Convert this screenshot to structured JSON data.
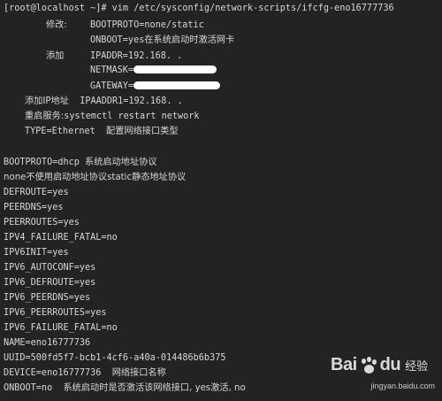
{
  "terminal": {
    "prompt_line": "[root@localhost ~]# vim /etc/sysconfig/network-scripts/ifcfg-eno16777736",
    "notes": {
      "modify_label": "修改:",
      "bootproto_static": "BOOTPROTO=none/static",
      "onboot_label": "ONBOOT=yes",
      "onboot_desc": "在系统启动时激活网卡",
      "add_label": "添加",
      "ipaddr": "IPADDR=192.168. .",
      "netmask": "NETMASK=",
      "gateway": "GATEWAY=",
      "add_ip_label": "添加IP地址",
      "ipaddr1": "IPAADDR1=192.168. .",
      "restart_label": "重启服务:",
      "restart_cmd": "systemctl restart network",
      "type_line": "TYPE=Ethernet",
      "type_desc": "配置网络接口类型"
    },
    "config": {
      "bootproto_dhcp": "BOOTPROTO=dhcp",
      "bootproto_dhcp_desc": "系统启动地址协议",
      "none_desc": "none不使用启动地址协议static静态地址协议",
      "defroute": "DEFROUTE=yes",
      "peerdns": "PEERDNS=yes",
      "peerroutes": "PEERROUTES=yes",
      "ipv4_failure_fatal": "IPV4_FAILURE_FATAL=no",
      "ipv6init": "IPV6INIT=yes",
      "ipv6_autoconf": "IPV6_AUTOCONF=yes",
      "ipv6_defroute": "IPV6_DEFROUTE=yes",
      "ipv6_peerdns": "IPV6_PEERDNS=yes",
      "ipv6_peerroutes": "IPV6_PEERROUTES=yes",
      "ipv6_failure_fatal": "IPV6_FAILURE_FATAL=no",
      "name": "NAME=eno16777736",
      "uuid": "UUID=500fd5f7-bcb1-4cf6-a40a-014486b6b375",
      "device": "DEVICE=eno16777736",
      "device_desc": "网络接口名称",
      "onboot_no": "ONBOOT=no",
      "onboot_no_desc": "系统启动时是否激活该网络接口, yes激活, no"
    }
  },
  "watermark": {
    "logo_bai": "Bai",
    "logo_du": "du",
    "logo_jingyan": "经验",
    "domain": "jingyan.baidu.com"
  },
  "colors": {
    "background": "#232323",
    "text": "#d6d6d6",
    "redaction": "#ffffff"
  }
}
